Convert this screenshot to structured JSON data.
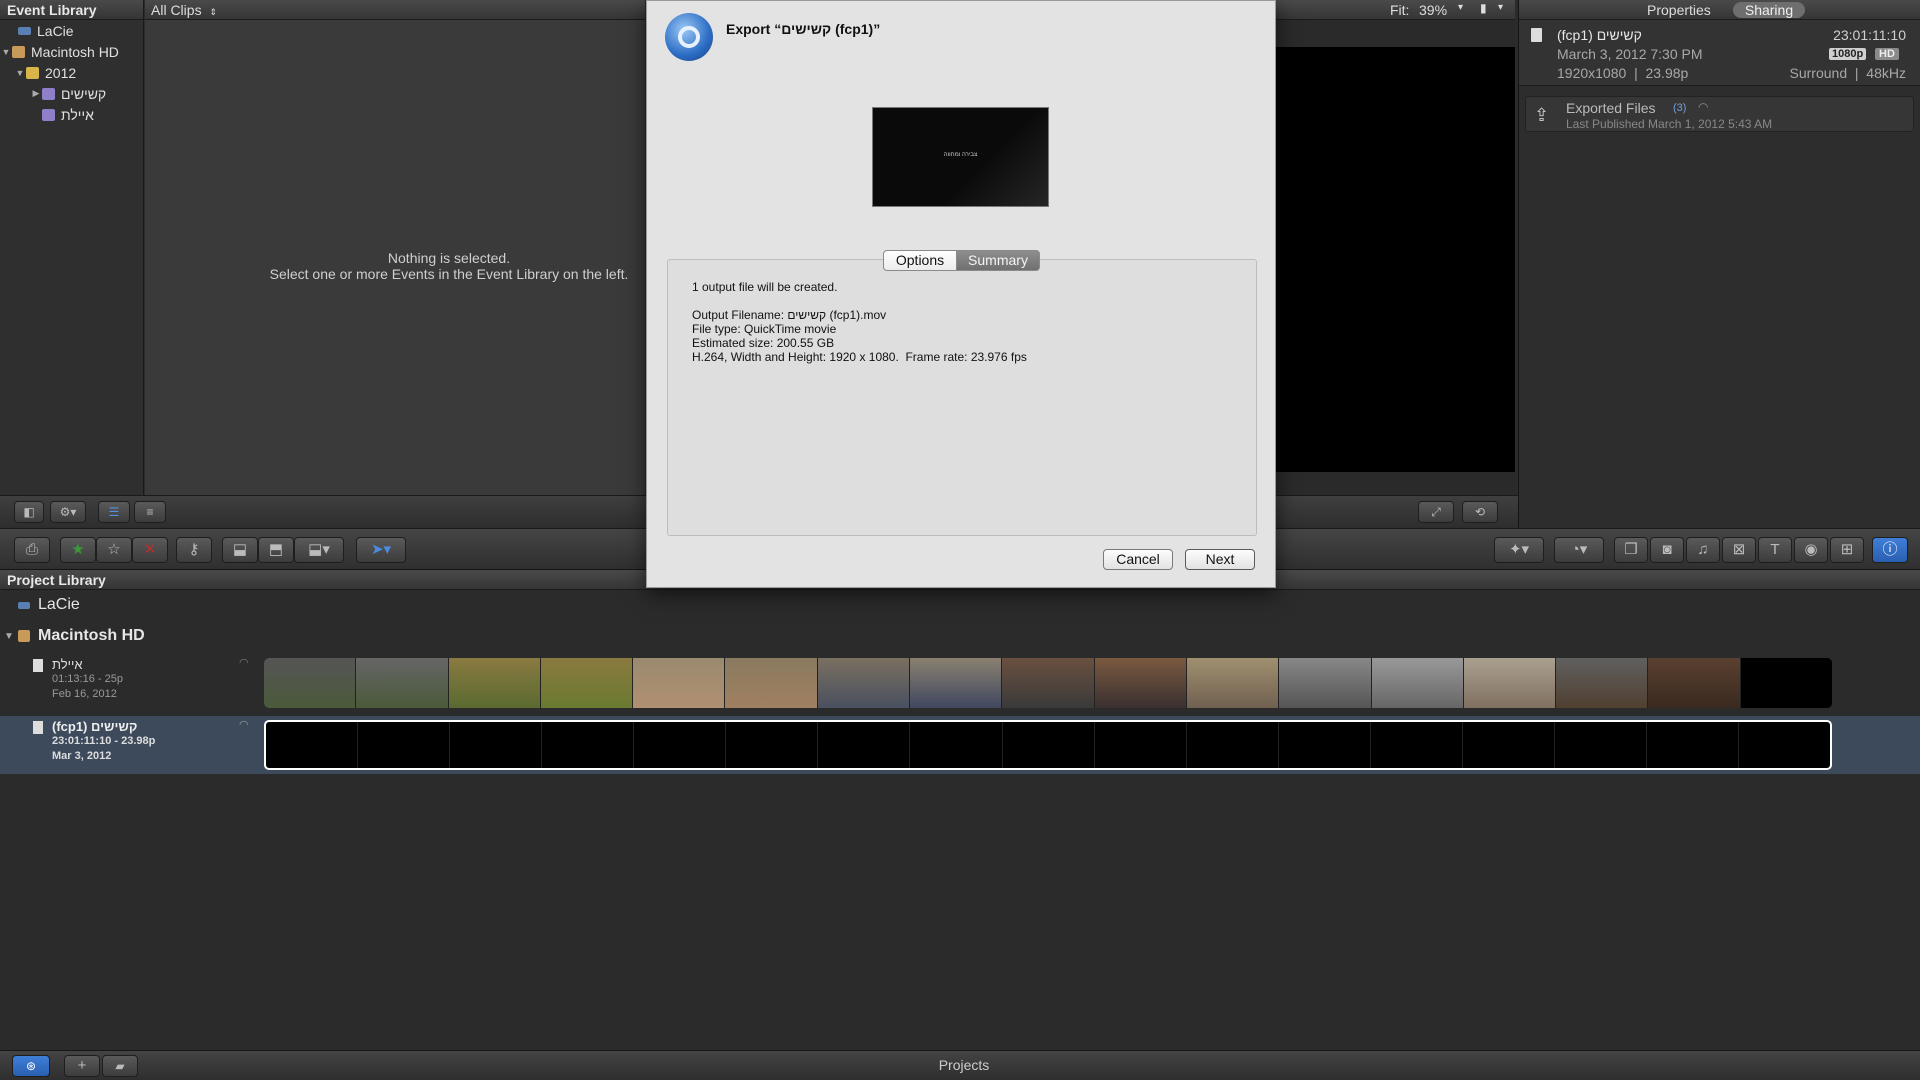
{
  "event_library": {
    "title": "Event Library",
    "items": [
      {
        "label": "LaCie"
      },
      {
        "label": "Macintosh HD"
      },
      {
        "label": "2012"
      },
      {
        "label": "קשישים"
      },
      {
        "label": "איילת"
      }
    ]
  },
  "browser": {
    "filter": "All Clips",
    "empty_line1": "Nothing is selected.",
    "empty_line2": "Select one or more Events in the Event Library on the left."
  },
  "viewer": {
    "fit_label": "Fit:",
    "fit_value": "39%"
  },
  "inspector": {
    "tab_properties": "Properties",
    "tab_sharing": "Sharing",
    "project_name": "(fcp1) קשישים",
    "duration": "23:01:11:10",
    "date": "March 3, 2012 7:30 PM",
    "res_badge": "1080p",
    "hd_badge": "HD",
    "format": "1920x1080  |  23.98p",
    "audio": "Surround  |  48kHz",
    "exported_title": "Exported Files",
    "exported_count": "(3)",
    "last_published": "Last Published March 1, 2012 5:43 AM"
  },
  "project_library": {
    "title": "Project Library",
    "drives": [
      {
        "label": "LaCie"
      },
      {
        "label": "Macintosh HD"
      }
    ],
    "projects": [
      {
        "name": "איילת",
        "duration": "01:13:16 - 25p",
        "date": "Feb 16, 2012"
      },
      {
        "name": "(fcp1) קשישים",
        "duration": "23:01:11:10 - 23.98p",
        "date": "Mar 3, 2012"
      }
    ]
  },
  "bottom_bar": {
    "label": "Projects"
  },
  "dialog": {
    "title": "Export “קשישים (fcp1)”",
    "preview_text": "צבירה ומחווה",
    "tab_options": "Options",
    "tab_summary": "Summary",
    "summary": [
      "1 output file will be created.",
      "",
      "Output Filename: קשישים (fcp1).mov",
      "File type: QuickTime movie",
      "Estimated size: 200.55 GB",
      "H.264, Width and Height: 1920 x 1080.  Frame rate: 23.976 fps"
    ],
    "cancel_label": "Cancel",
    "next_label": "Next"
  },
  "colors": {
    "accent_blue": "#2f6fd6",
    "selected_row": "#3d4a5c"
  }
}
